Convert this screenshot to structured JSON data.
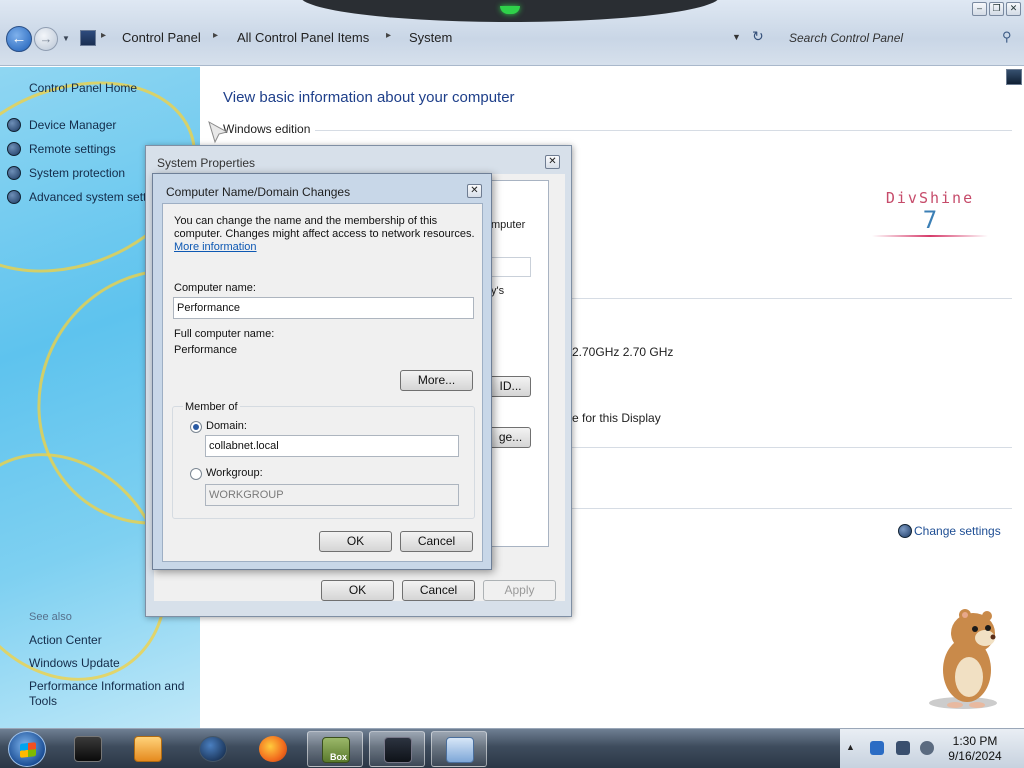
{
  "window": {
    "controls": [
      "minimize",
      "restore",
      "close"
    ]
  },
  "address_bar": {
    "breadcrumbs": [
      "Control Panel",
      "All Control Panel Items",
      "System"
    ],
    "search_placeholder": "Search Control Panel"
  },
  "sidebar": {
    "home": "Control Panel Home",
    "tasks": [
      "Device Manager",
      "Remote settings",
      "System protection",
      "Advanced system sett"
    ],
    "see_also_label": "See also",
    "see_also": [
      "Action Center",
      "Windows Update",
      "Performance Information and Tools"
    ]
  },
  "main": {
    "title": "View basic information about your computer",
    "windows_edition_label": "Windows edition",
    "logo_line1": "DivShine",
    "logo_line2": "7",
    "processor": "2.70GHz   2.70 GHz",
    "display_note": "e for this Display",
    "change_settings": "Change settings"
  },
  "system_properties": {
    "title": "System Properties",
    "ghost_tab": "ote",
    "ghost_text1": "mputer",
    "ghost_text2": "y's",
    "ghost_btn1": "ID...",
    "ghost_btn2": "ge...",
    "ok": "OK",
    "cancel": "Cancel",
    "apply": "Apply"
  },
  "name_domain_dialog": {
    "title": "Computer Name/Domain Changes",
    "description_line1": "You can change the name and the membership of this",
    "description_line2": "computer. Changes might affect access to network resources.",
    "more_info_link": "More information",
    "computer_name_label": "Computer name:",
    "computer_name_value": "Performance",
    "full_name_label": "Full computer name:",
    "full_name_value": "Performance",
    "more_button": "More...",
    "member_of_label": "Member of",
    "domain_label": "Domain:",
    "domain_value": "collabnet.local",
    "workgroup_label": "Workgroup:",
    "workgroup_value": "WORKGROUP",
    "ok": "OK",
    "cancel": "Cancel"
  },
  "taskbar": {
    "time": "1:30 PM",
    "date": "9/16/2024",
    "box_label": "Box"
  }
}
